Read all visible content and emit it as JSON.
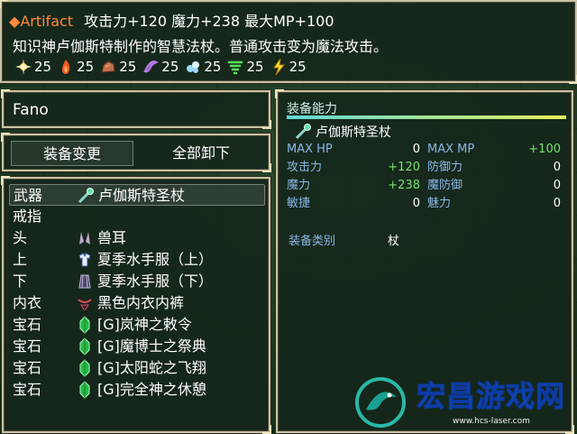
{
  "help": {
    "item_name": "Artifact",
    "stats": "攻击力+120 魔力+238 最大MP+100",
    "description": "知识神卢伽斯特制作的智慧法杖。普通攻击变为魔法攻击。",
    "resistances": [
      {
        "icon": "fire-burst-icon",
        "value": "25",
        "color": "#ffd060"
      },
      {
        "icon": "flame-icon",
        "value": "25",
        "color": "#ff5a1e"
      },
      {
        "icon": "rock-icon",
        "value": "25",
        "color": "#c0704a"
      },
      {
        "icon": "wind-icon",
        "value": "25",
        "color": "#b878e8"
      },
      {
        "icon": "ice-crystal-icon",
        "value": "25",
        "color": "#9ad8ff"
      },
      {
        "icon": "tornado-icon",
        "value": "25",
        "color": "#58e058"
      },
      {
        "icon": "lightning-icon",
        "value": "25",
        "color": "#ffe040"
      }
    ]
  },
  "actor": {
    "name": "Fano"
  },
  "commands": {
    "equip": "装备变更",
    "clear": "全部卸下"
  },
  "slots": [
    {
      "label": "武器",
      "item": "卢伽斯特圣杖",
      "icon": "staff-icon"
    },
    {
      "label": "戒指",
      "item": "",
      "icon": ""
    },
    {
      "label": "头",
      "item": "兽耳",
      "icon": "animal-ears-icon"
    },
    {
      "label": "上",
      "item": "夏季水手服（上）",
      "icon": "shirt-icon"
    },
    {
      "label": "下",
      "item": "夏季水手服（下）",
      "icon": "skirt-icon"
    },
    {
      "label": "内衣",
      "item": "黑色内衣内裤",
      "icon": "underwear-icon"
    },
    {
      "label": "宝石",
      "item": "[G]岚神之敕令",
      "icon": "gem-icon"
    },
    {
      "label": "宝石",
      "item": "[G]魔博士之祭典",
      "icon": "gem-icon"
    },
    {
      "label": "宝石",
      "item": "[G]太阳蛇之飞翔",
      "icon": "gem-icon"
    },
    {
      "label": "宝石",
      "item": "[G]完全神之休憩",
      "icon": "gem-icon"
    }
  ],
  "status": {
    "title": "装备能力",
    "item": "卢伽斯特圣杖",
    "params": [
      {
        "name": "MAX HP",
        "value": "0",
        "green": false
      },
      {
        "name": "MAX MP",
        "value": "+100",
        "green": true
      },
      {
        "name": "攻击力",
        "value": "+120",
        "green": true
      },
      {
        "name": "防御力",
        "value": "0",
        "green": false
      },
      {
        "name": "魔力",
        "value": "+238",
        "green": true
      },
      {
        "name": "魔防御",
        "value": "0",
        "green": false
      },
      {
        "name": "敏捷",
        "value": "0",
        "green": false
      },
      {
        "name": "魅力",
        "value": "0",
        "green": false
      }
    ],
    "category_label": "装备类别",
    "category_value": "杖"
  },
  "watermark": {
    "text": "宏昌游戏网",
    "url": "www.hcs-laser.com"
  },
  "colors": {
    "accent_orange": "#ff8a3d",
    "param_blue": "#8ab6e8",
    "gain_green": "#78e070"
  }
}
